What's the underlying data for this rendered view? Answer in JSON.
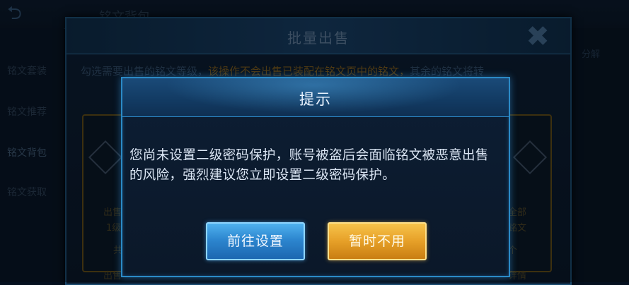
{
  "background": {
    "title": "铭文背包",
    "sidebar": [
      "铭文套装",
      "铭文推荐",
      "铭文背包",
      "铭文获取"
    ],
    "right_label": "分解"
  },
  "batch_sell": {
    "title": "批量出售",
    "description_normal": "勾选需要出售的铭文等级，",
    "description_warning": "该操作不会出售已装配在铭文页中的铭文，",
    "description_tail": "其余的铭文将转",
    "left_card": {
      "line1": "出售",
      "line2": "1级",
      "line3": "共",
      "footer": "出售"
    },
    "right_card": {
      "line1": "全部",
      "line2": "铭文",
      "line3": "个",
      "footer": "详情"
    }
  },
  "prompt": {
    "title": "提示",
    "message": "您尚未设置二级密码保护，账号被盗后会面临铭文被恶意出售的风险，强烈建议您立即设置二级密码保护。",
    "primary_button": "前往设置",
    "secondary_button": "暂时不用"
  },
  "colors": {
    "accent_blue": "#2d86cf",
    "accent_gold": "#e6a028",
    "warning_text": "#c98a1e"
  }
}
